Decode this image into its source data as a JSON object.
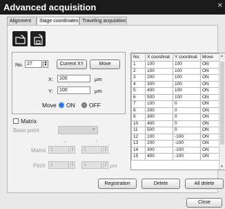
{
  "window": {
    "title": "Advanced acquisition",
    "close_glyph": "✕"
  },
  "tabs": [
    {
      "label": "Alignment"
    },
    {
      "label": "Stage coordinates"
    },
    {
      "label": "Traveling acquisition"
    }
  ],
  "icons": {
    "open": "folder-open-icon",
    "save": "save-disk-icon"
  },
  "position": {
    "no_label": "No.",
    "no_value": "27",
    "current_xy_label": "Current XY",
    "move_button_label": "Move",
    "x_label": "X:",
    "x_value": "100",
    "x_unit": "μm",
    "y_label": "Y:",
    "y_value": "100",
    "y_unit": "μm",
    "move_label": "Move",
    "on_label": "ON",
    "off_label": "OFF"
  },
  "matrix": {
    "checkbox_label": "Matrix",
    "base_point_label": "Base point",
    "base_point_value": "",
    "arrow_right": "→",
    "arrow_down": "↓",
    "matrix_label": "Matrix",
    "matrix_x": "1",
    "matrix_y": "1",
    "pitch_label": "Pitch",
    "pitch_x": "1",
    "pitch_y": "1",
    "pitch_unit": "μm"
  },
  "table": {
    "columns": [
      "No.",
      "X coordinat",
      "Y coordinat",
      "Move"
    ],
    "rows": [
      [
        "1",
        "100",
        "100",
        "ON"
      ],
      [
        "2",
        "100",
        "100",
        "ON"
      ],
      [
        "3",
        "200",
        "100",
        "ON"
      ],
      [
        "4",
        "300",
        "100",
        "ON"
      ],
      [
        "5",
        "400",
        "100",
        "ON"
      ],
      [
        "6",
        "500",
        "100",
        "ON"
      ],
      [
        "7",
        "100",
        "0",
        "ON"
      ],
      [
        "8",
        "200",
        "0",
        "ON"
      ],
      [
        "9",
        "300",
        "0",
        "ON"
      ],
      [
        "10",
        "400",
        "0",
        "ON"
      ],
      [
        "11",
        "500",
        "0",
        "ON"
      ],
      [
        "12",
        "100",
        "-100",
        "ON"
      ],
      [
        "13",
        "200",
        "-100",
        "ON"
      ],
      [
        "14",
        "300",
        "-100",
        "ON"
      ],
      [
        "15",
        "400",
        "-100",
        "ON"
      ]
    ]
  },
  "actions": {
    "registration_label": "Registration",
    "delete_label": "Delete",
    "all_delete_label": "All delete",
    "close_label": "Close"
  }
}
